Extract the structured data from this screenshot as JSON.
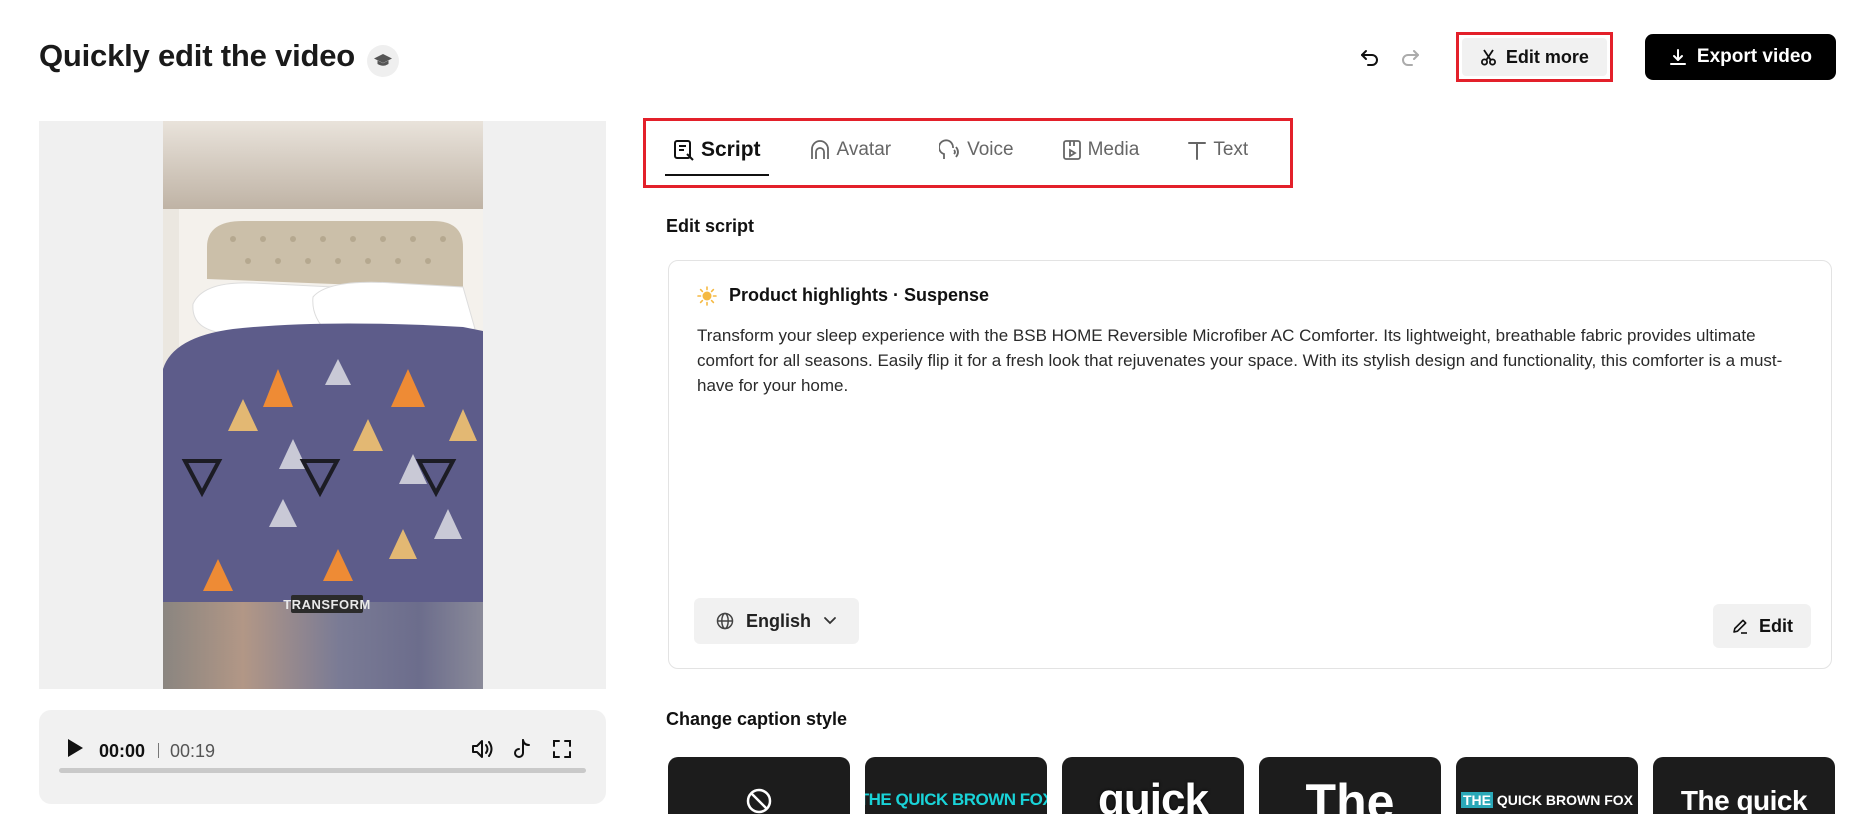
{
  "header": {
    "title": "Quickly edit the video",
    "edit_more_label": "Edit more",
    "export_label": "Export video"
  },
  "player": {
    "current_time": "00:00",
    "total_time": "00:19",
    "progress_fraction": 0
  },
  "preview": {
    "caption_text": "TRANSFORM"
  },
  "tabs": [
    {
      "label": "Script",
      "icon": "script-icon",
      "active": true
    },
    {
      "label": "Avatar",
      "icon": "avatar-icon",
      "active": false
    },
    {
      "label": "Voice",
      "icon": "voice-icon",
      "active": false
    },
    {
      "label": "Media",
      "icon": "media-icon",
      "active": false
    },
    {
      "label": "Text",
      "icon": "text-icon",
      "active": false
    }
  ],
  "script": {
    "section_label": "Edit script",
    "heading": "Product highlights · Suspense",
    "body": "Transform your sleep experience with the BSB HOME Reversible Microfiber AC Comforter. Its lightweight, breathable fabric provides ultimate comfort for all seasons. Easily flip it for a fresh look that rejuvenates your space. With its stylish design and functionality, this comforter is a must-have for your home.",
    "language": "English",
    "edit_label": "Edit"
  },
  "captions": {
    "section_label": "Change caption style",
    "styles": [
      {
        "text": "",
        "icon": "none-icon"
      },
      {
        "text": "THE QUICK BROWN FOX"
      },
      {
        "text": "quick"
      },
      {
        "text": "The"
      },
      {
        "text_highlight": "THE",
        "text": "QUICK BROWN FOX"
      },
      {
        "text": "The quick"
      }
    ]
  },
  "colors": {
    "accent_red": "#e3202a",
    "caption_teal": "#19d3d8",
    "button_dark": "#000000"
  }
}
